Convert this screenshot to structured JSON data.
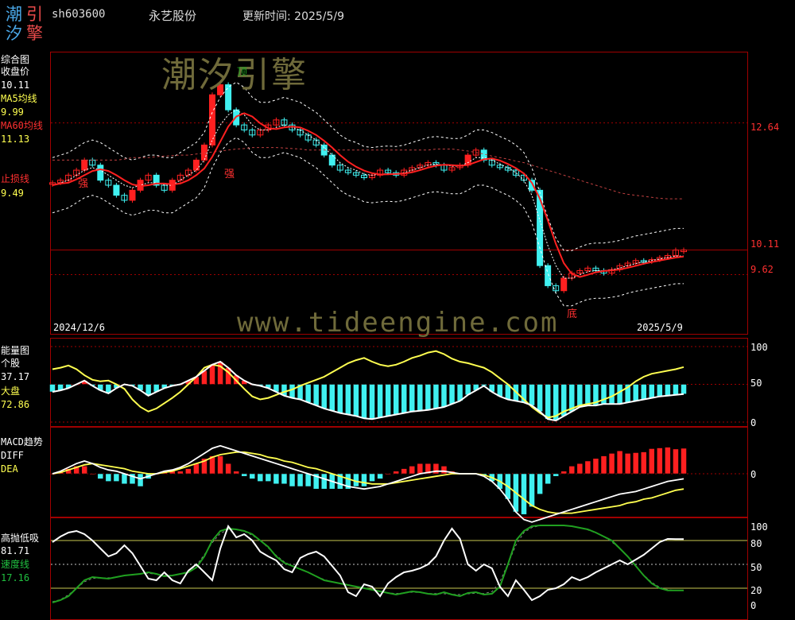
{
  "header": {
    "logo": [
      "潮",
      "引",
      "汐",
      "擎"
    ],
    "code": "sh603600",
    "name": "永艺股份",
    "updated": "更新时间: 2025/5/9"
  },
  "watermark": {
    "cn": "潮汐引擎",
    "url": "www.tideengine.com"
  },
  "colors": {
    "red": "#ff2020",
    "cyan": "#40f0f0",
    "yellow": "#ffff50",
    "white": "#ffffff",
    "green": "#20a020",
    "grid": "#a00000"
  },
  "main": {
    "title": "综合图",
    "close_label": "收盘价",
    "close_value": "10.11",
    "ma5_label": "MA5均线",
    "ma5_value": "9.99",
    "ma60_label": "MA60均线",
    "ma60_value": "11.13",
    "stop_label": "止损线",
    "stop_value": "9.49",
    "axis_right": [
      "12.64",
      "10.11",
      "9.62"
    ],
    "date_start": "2024/12/6",
    "date_end": "2025/5/9",
    "marks": {
      "top": "顶",
      "bottom": "底",
      "strong1": "强",
      "strong2": "强"
    }
  },
  "energy": {
    "title": "能量图",
    "stock_label": "个股",
    "stock_value": "37.17",
    "market_label": "大盘",
    "market_value": "72.86",
    "axis_right": [
      "100",
      "50",
      "0"
    ]
  },
  "macd": {
    "title": "MACD趋势",
    "diff_label": "DIFF",
    "dea_label": "DEA",
    "axis_right": [
      "0"
    ]
  },
  "hl": {
    "title": "高抛低吸",
    "value": "81.71",
    "speed_label": "速度线",
    "speed_value": "17.16",
    "axis_right": [
      "100",
      "80",
      "50",
      "20",
      "0"
    ]
  },
  "chart_data": [
    {
      "type": "candlestick",
      "title": "综合图",
      "x_range": [
        "2024/12/6",
        "2025/5/9"
      ],
      "ylim": [
        8.6,
        13.9
      ],
      "series": [
        {
          "name": "收盘价",
          "close": [
            11.45,
            11.5,
            11.6,
            11.7,
            11.9,
            11.8,
            11.5,
            11.4,
            11.2,
            11.1,
            11.3,
            11.5,
            11.6,
            11.4,
            11.3,
            11.5,
            11.6,
            11.7,
            11.9,
            12.2,
            13.2,
            13.4,
            12.9,
            12.6,
            12.5,
            12.4,
            12.5,
            12.6,
            12.7,
            12.6,
            12.5,
            12.4,
            12.3,
            12.2,
            12.0,
            11.8,
            11.7,
            11.65,
            11.6,
            11.55,
            11.6,
            11.7,
            11.65,
            11.6,
            11.7,
            11.75,
            11.8,
            11.85,
            11.8,
            11.7,
            11.75,
            11.8,
            12.0,
            12.1,
            11.9,
            11.8,
            11.75,
            11.7,
            11.6,
            11.5,
            11.3,
            9.8,
            9.4,
            9.3,
            9.55,
            9.65,
            9.7,
            9.75,
            9.7,
            9.65,
            9.72,
            9.8,
            9.85,
            9.9,
            9.88,
            9.92,
            9.96,
            10.0,
            10.11,
            10.11
          ]
        },
        {
          "name": "MA5均线",
          "values": [
            11.4,
            11.45,
            11.5,
            11.6,
            11.7,
            11.75,
            11.7,
            11.6,
            11.5,
            11.4,
            11.35,
            11.4,
            11.45,
            11.45,
            11.4,
            11.4,
            11.5,
            11.6,
            11.7,
            11.9,
            12.3,
            12.6,
            12.8,
            12.9,
            12.8,
            12.6,
            12.5,
            12.5,
            12.55,
            12.6,
            12.55,
            12.5,
            12.4,
            12.3,
            12.15,
            12.0,
            11.85,
            11.75,
            11.7,
            11.62,
            11.6,
            11.62,
            11.63,
            11.62,
            11.65,
            11.7,
            11.75,
            11.8,
            11.82,
            11.8,
            11.78,
            11.78,
            11.85,
            11.95,
            11.95,
            11.9,
            11.82,
            11.75,
            11.65,
            11.5,
            11.2,
            10.7,
            10.2,
            9.8,
            9.55,
            9.55,
            9.62,
            9.68,
            9.7,
            9.7,
            9.72,
            9.75,
            9.8,
            9.84,
            9.87,
            9.9,
            9.93,
            9.96,
            9.99,
            9.99
          ]
        },
        {
          "name": "MA60均线",
          "values": [
            11.9,
            11.9,
            11.9,
            11.9,
            11.9,
            11.9,
            11.9,
            11.9,
            11.9,
            11.92,
            11.95,
            11.95,
            11.95,
            11.97,
            11.98,
            11.99,
            12.0,
            12.0,
            12.02,
            12.04,
            12.06,
            12.08,
            12.1,
            12.12,
            12.13,
            12.15,
            12.15,
            12.15,
            12.15,
            12.14,
            12.13,
            12.12,
            12.1,
            12.1,
            12.1,
            12.1,
            12.1,
            12.1,
            12.1,
            12.1,
            12.1,
            12.1,
            12.1,
            12.1,
            12.1,
            12.1,
            12.1,
            12.1,
            12.12,
            12.12,
            12.12,
            12.1,
            12.08,
            12.05,
            12.02,
            11.98,
            11.95,
            11.92,
            11.88,
            11.85,
            11.8,
            11.75,
            11.7,
            11.65,
            11.6,
            11.55,
            11.5,
            11.45,
            11.4,
            11.35,
            11.3,
            11.25,
            11.22,
            11.2,
            11.18,
            11.16,
            11.14,
            11.13,
            11.13,
            11.13
          ]
        }
      ]
    },
    {
      "type": "bar+line",
      "title": "能量图",
      "ylim": [
        0,
        100
      ],
      "series": [
        {
          "name": "个股",
          "values": [
            70,
            72,
            75,
            70,
            62,
            56,
            54,
            55,
            50,
            44,
            30,
            20,
            14,
            18,
            25,
            32,
            40,
            50,
            60,
            72,
            76,
            74,
            66,
            55,
            44,
            34,
            30,
            32,
            36,
            40,
            43,
            48,
            52,
            56,
            60,
            66,
            72,
            78,
            82,
            85,
            80,
            76,
            74,
            76,
            80,
            85,
            88,
            92,
            94,
            90,
            84,
            80,
            78,
            75,
            72,
            66,
            58,
            50,
            40,
            30,
            20,
            12,
            6,
            8,
            14,
            18,
            22,
            24,
            26,
            30,
            34,
            40,
            46,
            54,
            60,
            64,
            66,
            68,
            70,
            72.86
          ]
        },
        {
          "name": "大盘",
          "values": [
            40,
            42,
            45,
            50,
            55,
            48,
            42,
            38,
            45,
            50,
            48,
            42,
            35,
            40,
            45,
            48,
            50,
            55,
            60,
            68,
            76,
            80,
            72,
            62,
            55,
            50,
            48,
            45,
            40,
            35,
            32,
            30,
            26,
            22,
            18,
            15,
            12,
            10,
            8,
            5,
            4,
            6,
            8,
            10,
            12,
            14,
            15,
            16,
            18,
            20,
            24,
            28,
            36,
            42,
            48,
            40,
            34,
            30,
            28,
            26,
            22,
            14,
            4,
            2,
            8,
            14,
            20,
            22,
            22,
            24,
            24,
            24,
            26,
            28,
            30,
            32,
            34,
            35,
            36,
            37.17
          ]
        }
      ]
    },
    {
      "type": "bar+line",
      "title": "MACD趋势",
      "series": [
        {
          "name": "DIFF",
          "values": [
            0,
            0.02,
            0.05,
            0.08,
            0.1,
            0.08,
            0.05,
            0.03,
            0.02,
            0.0,
            -0.02,
            -0.04,
            -0.02,
            0.0,
            0.02,
            0.03,
            0.05,
            0.08,
            0.12,
            0.16,
            0.2,
            0.22,
            0.2,
            0.18,
            0.16,
            0.14,
            0.12,
            0.1,
            0.08,
            0.06,
            0.04,
            0.02,
            0.0,
            -0.02,
            -0.04,
            -0.06,
            -0.08,
            -0.1,
            -0.11,
            -0.12,
            -0.11,
            -0.1,
            -0.08,
            -0.06,
            -0.04,
            -0.02,
            0.0,
            0.01,
            0.02,
            0.02,
            0.01,
            0.0,
            0.0,
            0.0,
            -0.02,
            -0.06,
            -0.12,
            -0.2,
            -0.3,
            -0.36,
            -0.38,
            -0.36,
            -0.34,
            -0.32,
            -0.3,
            -0.28,
            -0.26,
            -0.24,
            -0.22,
            -0.2,
            -0.18,
            -0.16,
            -0.15,
            -0.14,
            -0.12,
            -0.1,
            -0.08,
            -0.06,
            -0.05,
            -0.04
          ]
        },
        {
          "name": "DEA",
          "values": [
            0,
            0.01,
            0.03,
            0.05,
            0.07,
            0.08,
            0.07,
            0.06,
            0.05,
            0.04,
            0.02,
            0.01,
            0.0,
            0.0,
            0.01,
            0.02,
            0.04,
            0.06,
            0.08,
            0.1,
            0.13,
            0.15,
            0.16,
            0.17,
            0.17,
            0.16,
            0.15,
            0.13,
            0.12,
            0.1,
            0.09,
            0.07,
            0.05,
            0.04,
            0.02,
            0.0,
            -0.02,
            -0.04,
            -0.06,
            -0.07,
            -0.08,
            -0.08,
            -0.08,
            -0.07,
            -0.06,
            -0.05,
            -0.04,
            -0.03,
            -0.02,
            -0.01,
            0.0,
            0.0,
            0.0,
            0.0,
            -0.01,
            -0.03,
            -0.06,
            -0.1,
            -0.15,
            -0.2,
            -0.25,
            -0.28,
            -0.3,
            -0.31,
            -0.31,
            -0.31,
            -0.3,
            -0.29,
            -0.28,
            -0.27,
            -0.26,
            -0.25,
            -0.23,
            -0.22,
            -0.2,
            -0.19,
            -0.17,
            -0.15,
            -0.13,
            -0.12
          ]
        }
      ]
    },
    {
      "type": "line",
      "title": "高抛低吸",
      "ylim": [
        0,
        100
      ],
      "series": [
        {
          "name": "高抛低吸",
          "values": [
            78,
            85,
            90,
            92,
            88,
            80,
            70,
            60,
            64,
            74,
            64,
            48,
            32,
            30,
            40,
            30,
            26,
            42,
            50,
            40,
            30,
            70,
            98,
            84,
            88,
            80,
            66,
            60,
            55,
            44,
            40,
            58,
            63,
            66,
            60,
            48,
            36,
            15,
            10,
            25,
            22,
            10,
            26,
            34,
            40,
            42,
            45,
            50,
            60,
            80,
            95,
            82,
            50,
            42,
            50,
            45,
            22,
            10,
            30,
            18,
            5,
            10,
            18,
            20,
            25,
            34,
            30,
            34,
            40,
            45,
            50,
            55,
            50,
            56,
            62,
            70,
            78,
            82,
            81.71,
            81.71
          ]
        },
        {
          "name": "速度线",
          "values": [
            2,
            5,
            10,
            20,
            30,
            34,
            33,
            32,
            34,
            36,
            37,
            38,
            40,
            38,
            35,
            36,
            38,
            40,
            46,
            60,
            80,
            92,
            95,
            94,
            92,
            88,
            80,
            72,
            60,
            52,
            48,
            44,
            40,
            35,
            30,
            28,
            26,
            24,
            22,
            20,
            18,
            16,
            14,
            12,
            14,
            16,
            15,
            13,
            12,
            15,
            12,
            10,
            14,
            15,
            12,
            13,
            22,
            50,
            80,
            92,
            98,
            99,
            99,
            99,
            99,
            98,
            96,
            94,
            90,
            85,
            80,
            70,
            60,
            48,
            36,
            26,
            20,
            17.16,
            17.16,
            17.16
          ]
        }
      ]
    }
  ]
}
